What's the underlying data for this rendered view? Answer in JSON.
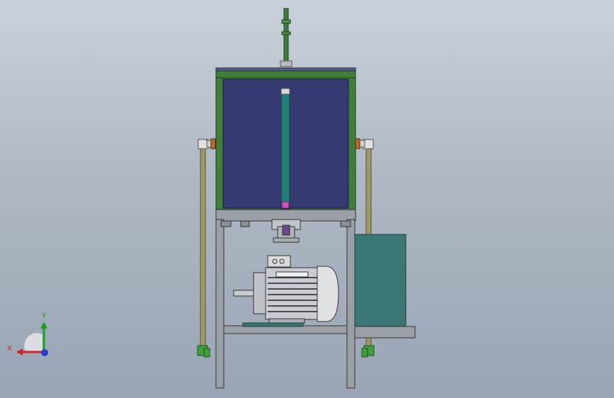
{
  "viewport": {
    "background_top": "#c9d1da",
    "background_bottom": "#99a5b4"
  },
  "colors": {
    "frame_green": "#3f7f3a",
    "tank_blue": "#363a72",
    "gauge_teal": "#1f7f78",
    "cabinet_teal": "#3a7774",
    "steel_gray": "#9aa0a6",
    "pipe_olive": "#9e9a66",
    "motor_silver": "#c9ccd0"
  },
  "triad": {
    "x_label": "X",
    "y_label": "Y",
    "x_color": "#d42020",
    "y_color": "#18a018",
    "z_color": "#1f3fd0"
  }
}
